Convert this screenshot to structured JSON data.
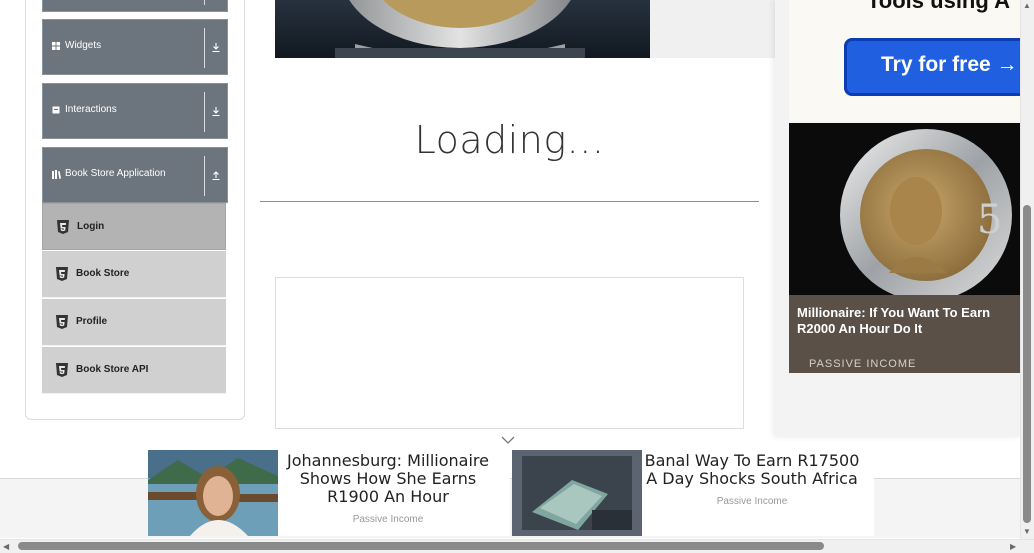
{
  "sidebar": {
    "groups": [
      {
        "label": "Widgets",
        "icon": "grid-icon",
        "arrow": "download-arrow-icon"
      },
      {
        "label": "Interactions",
        "icon": "square-icon",
        "arrow": "download-arrow-icon"
      },
      {
        "label": "Book Store Application",
        "icon": "books-icon",
        "arrow": "upload-arrow-icon"
      }
    ],
    "items": [
      {
        "label": "Login",
        "active": true,
        "icon": "html5-icon"
      },
      {
        "label": "Book Store",
        "active": false,
        "icon": "html5-icon"
      },
      {
        "label": "Profile",
        "active": false,
        "icon": "html5-icon"
      },
      {
        "label": "Book Store API",
        "active": false,
        "icon": "html5-icon"
      }
    ]
  },
  "main": {
    "loading_text": "Loading..."
  },
  "right_ad": {
    "cut_text": "Tools using A",
    "cta_label": "Try for free →",
    "title": "Millionaire: If You Want To Earn R2000 An Hour Do It",
    "source": "PASSIVE INCOME"
  },
  "bottom_ads": [
    {
      "title": "Johannesburg: Millionaire Shows How She Earns R1900 An Hour",
      "source": "Passive Income"
    },
    {
      "title": "Banal Way To Earn R17500 A Day Shocks South Africa",
      "source": "Passive Income"
    }
  ],
  "colors": {
    "sidebar_header": "#6c757d",
    "menu_item": "#d0d0d0",
    "menu_item_active": "#b3b3b3",
    "cta_blue": "#1f5fe0"
  }
}
